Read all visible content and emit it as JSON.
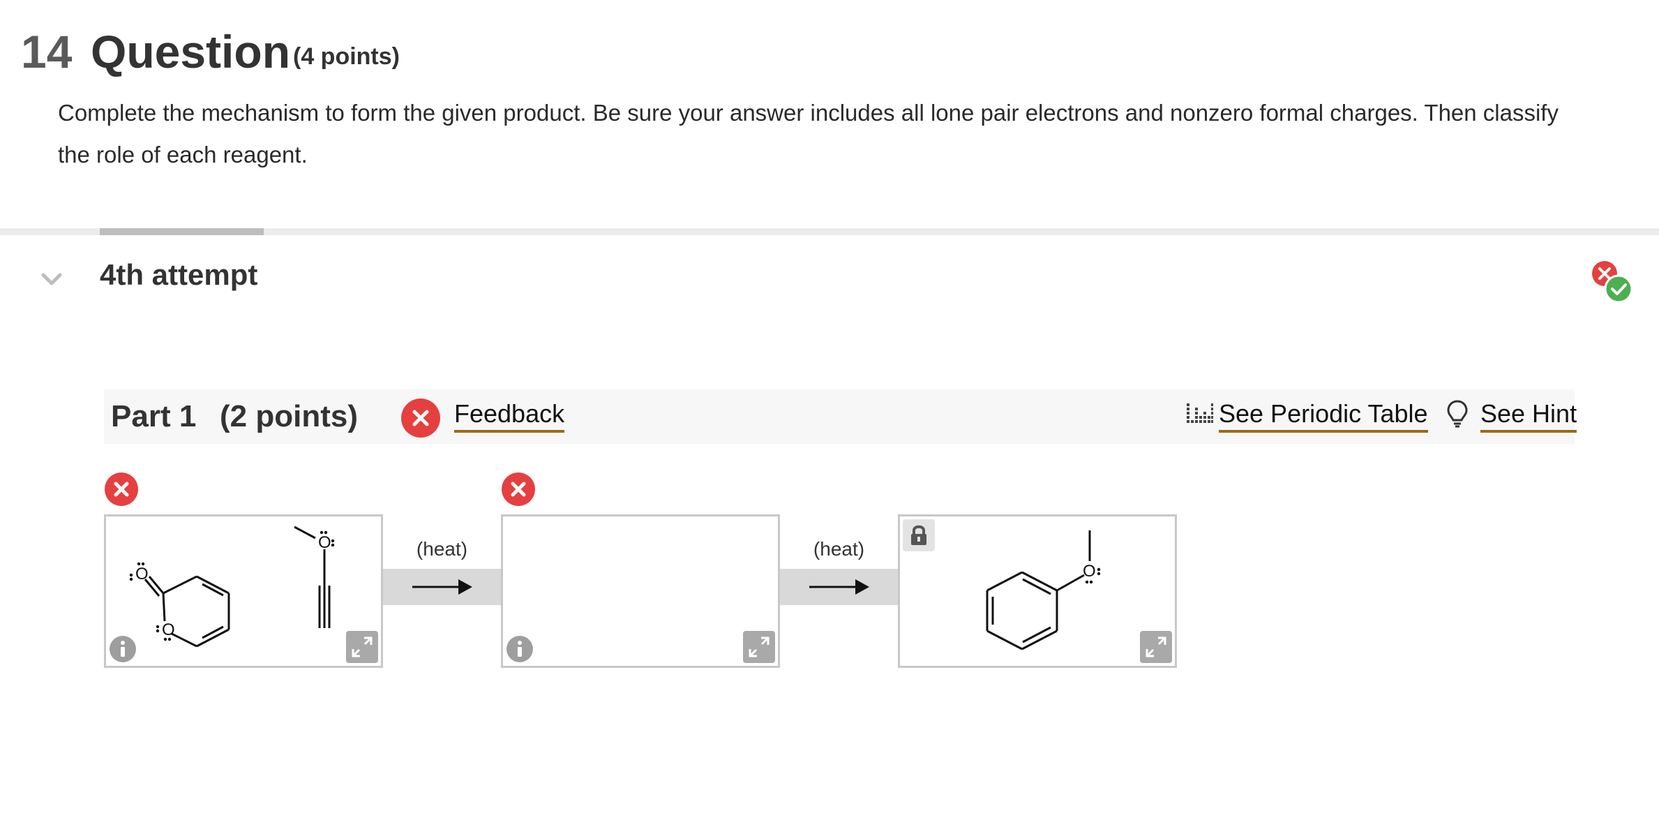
{
  "question": {
    "number": "14",
    "title": "Question",
    "points": "(4 points)",
    "text": "Complete the mechanism to form the given product. Be sure your answer includes all lone pair electrons and nonzero formal charges. Then classify the role of each reagent."
  },
  "attempt": {
    "label": "4th attempt",
    "status_icons": [
      "incorrect-icon",
      "correct-icon"
    ]
  },
  "part": {
    "label": "Part 1",
    "points": "(2 points)",
    "feedback_link": "Feedback",
    "periodic_table_link": "See Periodic Table",
    "hint_link": "See Hint"
  },
  "mechanism": {
    "steps": [
      {
        "condition": "(heat)"
      },
      {
        "condition": "(heat)"
      }
    ],
    "boxes": [
      {
        "status": "incorrect",
        "content": "reactants",
        "atoms": [
          "O",
          "O",
          "O"
        ]
      },
      {
        "status": "incorrect",
        "content": "empty"
      },
      {
        "status": "locked",
        "content": "product",
        "atoms": [
          "O"
        ]
      }
    ]
  },
  "colors": {
    "error_red": "#e5403f",
    "success_green": "#4caf50",
    "link_underline": "#9c6a16",
    "icon_gray": "#9e9e9e"
  }
}
